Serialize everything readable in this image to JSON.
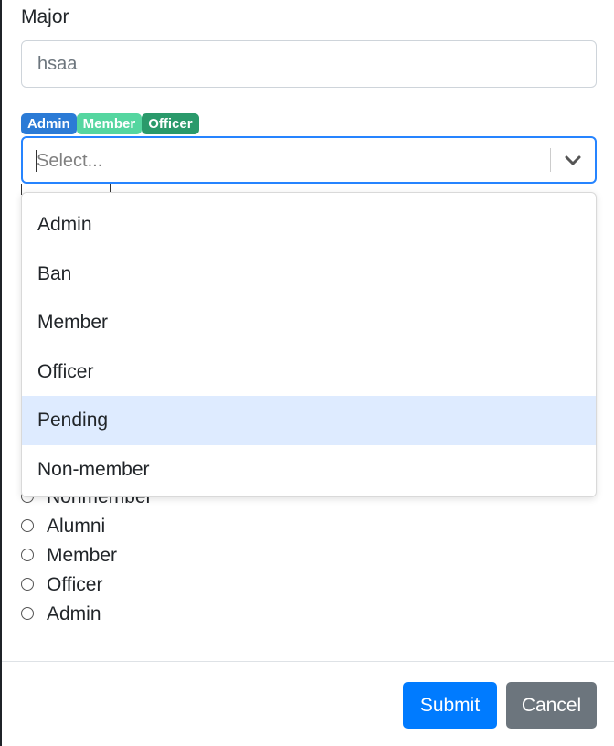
{
  "form": {
    "major_label": "Major",
    "major_value": "hsaa"
  },
  "roles": {
    "selected_badges": [
      "Admin",
      "Member",
      "Officer"
    ],
    "badge_colors": {
      "Admin": "#2b7bd6",
      "Member": "#55d6a0",
      "Officer": "#2a9a6b"
    },
    "select_placeholder": "Select...",
    "dropdown_options": [
      "Admin",
      "Ban",
      "Member",
      "Officer",
      "Pending",
      "Non-member"
    ],
    "highlighted_option": "Pending"
  },
  "status_radios": {
    "options": [
      "Nonmember",
      "Alumni",
      "Member",
      "Officer",
      "Admin"
    ]
  },
  "footer": {
    "submit_label": "Submit",
    "cancel_label": "Cancel"
  },
  "icons": {
    "dropdown_indicator": "chevron-down-icon"
  },
  "colors": {
    "focus_border": "#2684ff",
    "option_highlight": "#deebff",
    "submit_bg": "#007bff",
    "cancel_bg": "#6c757d"
  }
}
